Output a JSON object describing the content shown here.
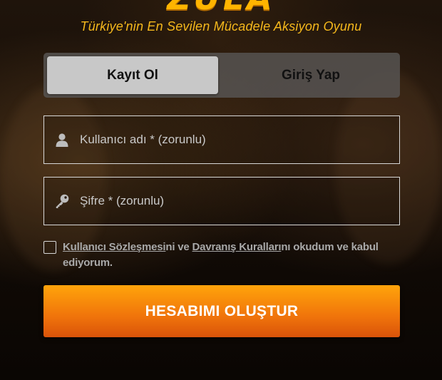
{
  "brand": {
    "logo_text": "ZULA",
    "tagline": "Türkiye'nin En Sevilen Mücadele Aksiyon Oyunu"
  },
  "tabs": [
    {
      "label": "Kayıt Ol",
      "active": true
    },
    {
      "label": "Giriş Yap",
      "active": false
    }
  ],
  "form": {
    "username": {
      "placeholder": "Kullanıcı adı * (zorunlu)",
      "value": "",
      "icon": "user-icon"
    },
    "password": {
      "placeholder": "Şifre * (zorunlu)",
      "value": "",
      "icon": "key-icon"
    },
    "agreement": {
      "checked": false,
      "link1": "Kullanıcı Sözleşmesi",
      "text1": "ni ve ",
      "link2": "Davranış Kuralları",
      "text2": "nı okudum ve kabul ediyorum."
    },
    "submit_label": "HESABIMI OLUŞTUR"
  },
  "colors": {
    "accent": "#ffb400",
    "button_top": "#ffa40b",
    "button_bottom": "#d9530a",
    "tab_active_bg": "#c8c8c8"
  }
}
